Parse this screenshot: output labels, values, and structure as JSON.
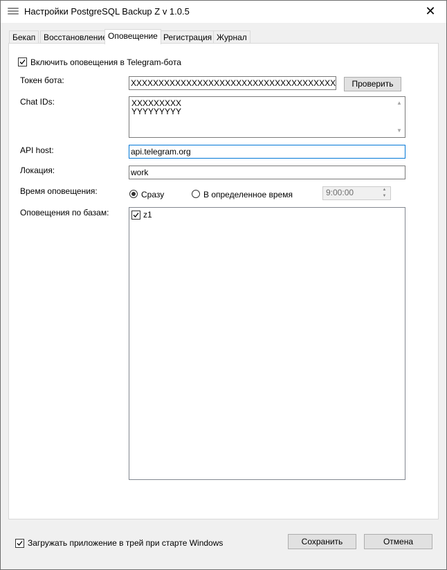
{
  "window": {
    "title": "Настройки PostgreSQL Backup Z v 1.0.5",
    "close_glyph": "✕"
  },
  "tabs": [
    {
      "label": "Бекап",
      "active": false
    },
    {
      "label": "Восстановление",
      "active": false
    },
    {
      "label": "Оповещение",
      "active": true
    },
    {
      "label": "Регистрация",
      "active": false
    },
    {
      "label": "Журнал",
      "active": false
    }
  ],
  "notify": {
    "enable_label": "Включить оповещения в Telegram-бота",
    "enable_checked": true,
    "token_label": "Токен бота:",
    "token_value": "XXXXXXXXXXXXXXXXXXXXXXXXXXXXXXXXXXXXXXXXXX",
    "check_button": "Проверить",
    "chatids_label": "Chat IDs:",
    "chatids_lines": [
      "XXXXXXXXX",
      "YYYYYYYYY"
    ],
    "apihost_label": "API host:",
    "apihost_value": "api.telegram.org",
    "location_label": "Локация:",
    "location_value": "work",
    "time_label": "Время оповещения:",
    "radio_immediate": "Сразу",
    "radio_immediate_checked": true,
    "radio_scheduled": "В определенное время",
    "radio_scheduled_checked": false,
    "time_value": "9:00:00",
    "db_label": "Оповещения по базам:",
    "databases": [
      {
        "name": "z1",
        "checked": true
      }
    ]
  },
  "footer": {
    "tray_label": "Загружать приложение в трей при старте Windows",
    "tray_checked": true,
    "save_button": "Сохранить",
    "cancel_button": "Отмена"
  }
}
